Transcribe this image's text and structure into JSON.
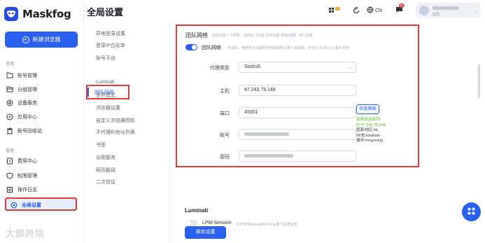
{
  "app": {
    "name": "Maskfog"
  },
  "sidebar": {
    "new_browser_label": "新建浏览器",
    "section_common": "常用",
    "section_manage": "管理",
    "items": [
      {
        "label": "账号管理",
        "icon": "folder-icon"
      },
      {
        "label": "分组管理",
        "icon": "folder-open-icon"
      },
      {
        "label": "设备服务",
        "icon": "settings-circle-icon"
      },
      {
        "label": "应用中心",
        "icon": "app-center-icon"
      },
      {
        "label": "账号回收站",
        "icon": "trash-icon"
      },
      {
        "label": "费用中心",
        "icon": "billing-icon"
      },
      {
        "label": "权限管理",
        "icon": "shield-icon"
      },
      {
        "label": "操作日志",
        "icon": "log-icon"
      },
      {
        "label": "全局设置",
        "icon": "settings-icon",
        "active": true
      }
    ],
    "watermark": "大脚跨境"
  },
  "topbar": {
    "title": "全局设置",
    "language": "CN",
    "notification_count": "51",
    "user_role": "成员"
  },
  "settings_nav": {
    "items": [
      "异地登录设置",
      "登录IP白名单",
      "账号平台",
      "团队网络",
      "Luminati",
      "多开模式",
      "浏览器设置",
      "自定义浏览器图标",
      "不代理的地址列表",
      "书签",
      "谷歌服务",
      "网页翻译",
      "二次验证"
    ],
    "active_index": 3
  },
  "team_network": {
    "title": "团队网络",
    "hint": "如需设置个人网络，请前往【设置-本地设置-网络设置】进行设置",
    "toggle_label": "团队网络",
    "toggle_on": true,
    "toggle_hint": "开启后，使用平台设备时浏览器将默认接入该线路，仅在v1.9.9及以上版本支持",
    "fields": {
      "proxy_type_label": "代理类型",
      "proxy_type_value": "Socks5",
      "host_label": "主机",
      "host_value": "47.243.75.148",
      "port_label": "端口",
      "port_value": "45001",
      "account_label": "账号",
      "password_label": "密码"
    },
    "check_button": "检查网络",
    "test_result": {
      "status": "连接测试成功!",
      "ip": "IP:47.243.75.148",
      "region": "国家/地区:hk",
      "province": "州/省:kowloon",
      "city": "城市:hong kong"
    }
  },
  "luminati": {
    "title": "Luminati",
    "lpm_label": "LPM-Session",
    "lpm_on": false,
    "lpm_hint": "针对使用luminati的LPM设置下需要勾选"
  },
  "actions": {
    "save_label": "保存设置"
  },
  "colors": {
    "accent": "#2a5ff0",
    "highlight_border": "#e03a3a",
    "success": "#52b81a"
  }
}
